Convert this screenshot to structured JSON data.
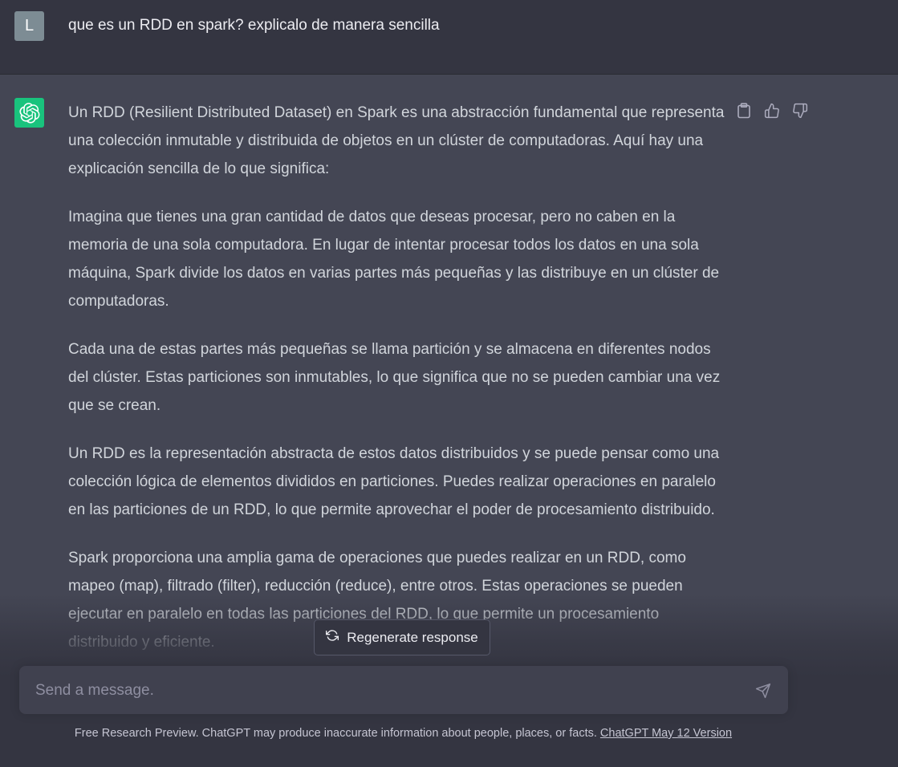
{
  "user_message": {
    "avatar_letter": "L",
    "text": "que es un RDD en spark? explicalo de manera sencilla"
  },
  "assistant_message": {
    "paragraphs": [
      "Un RDD (Resilient Distributed Dataset) en Spark es una abstracción fundamental que representa una colección inmutable y distribuida de objetos en un clúster de computadoras. Aquí hay una explicación sencilla de lo que significa:",
      "Imagina que tienes una gran cantidad de datos que deseas procesar, pero no caben en la memoria de una sola computadora. En lugar de intentar procesar todos los datos en una sola máquina, Spark divide los datos en varias partes más pequeñas y las distribuye en un clúster de computadoras.",
      "Cada una de estas partes más pequeñas se llama partición y se almacena en diferentes nodos del clúster. Estas particiones son inmutables, lo que significa que no se pueden cambiar una vez que se crean.",
      "Un RDD es la representación abstracta de estos datos distribuidos y se puede pensar como una colección lógica de elementos divididos en particiones. Puedes realizar operaciones en paralelo en las particiones de un RDD, lo que permite aprovechar el poder de procesamiento distribuido.",
      "Spark proporciona una amplia gama de operaciones que puedes realizar en un RDD, como mapeo (map), filtrado (filter), reducción (reduce), entre otros. Estas operaciones se pueden ejecutar en paralelo en todas las particiones del RDD, lo que permite un procesamiento distribuido y eficiente."
    ],
    "actions": {
      "copy_icon": "clipboard-icon",
      "like_icon": "thumbs-up-icon",
      "dislike_icon": "thumbs-down-icon"
    }
  },
  "regenerate": {
    "label": "Regenerate response",
    "icon": "refresh-icon"
  },
  "composer": {
    "placeholder": "Send a message.",
    "send_icon": "send-icon"
  },
  "footer": {
    "text": "Free Research Preview. ChatGPT may produce inaccurate information about people, places, or facts.",
    "link": "ChatGPT May 12 Version"
  },
  "colors": {
    "user_bg": "#343541",
    "assistant_bg": "#444654",
    "gpt_avatar": "#19c37d",
    "user_avatar": "#7d8c94"
  }
}
